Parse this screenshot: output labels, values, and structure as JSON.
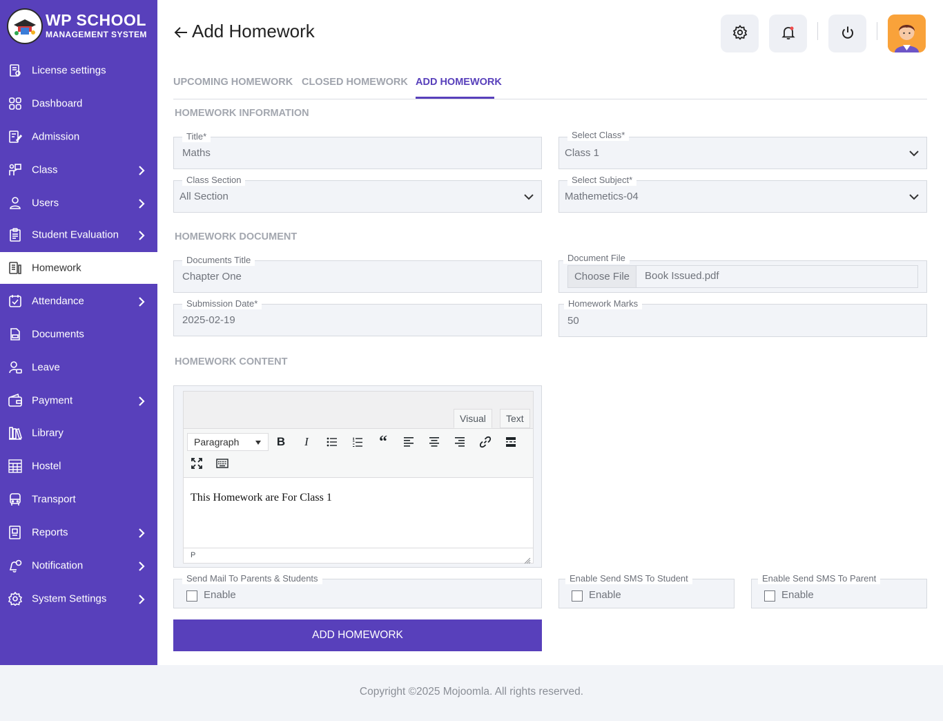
{
  "brand": {
    "title": "WP SCHOOL",
    "subtitle": "MANAGEMENT SYSTEM"
  },
  "sidebar": {
    "items": [
      {
        "label": "License settings",
        "icon": "license-icon",
        "has_submenu": false
      },
      {
        "label": "Dashboard",
        "icon": "grid-icon",
        "has_submenu": false
      },
      {
        "label": "Admission",
        "icon": "admission-icon",
        "has_submenu": false
      },
      {
        "label": "Class",
        "icon": "class-icon",
        "has_submenu": true
      },
      {
        "label": "Users",
        "icon": "user-icon",
        "has_submenu": true
      },
      {
        "label": "Student Evaluation",
        "icon": "evaluation-icon",
        "has_submenu": true
      },
      {
        "label": "Homework",
        "icon": "homework-icon",
        "has_submenu": false,
        "active": true
      },
      {
        "label": "Attendance",
        "icon": "attendance-icon",
        "has_submenu": true
      },
      {
        "label": "Documents",
        "icon": "document-icon",
        "has_submenu": false
      },
      {
        "label": "Leave",
        "icon": "leave-icon",
        "has_submenu": false
      },
      {
        "label": "Payment",
        "icon": "wallet-icon",
        "has_submenu": true
      },
      {
        "label": "Library",
        "icon": "library-icon",
        "has_submenu": false
      },
      {
        "label": "Hostel",
        "icon": "hostel-icon",
        "has_submenu": false
      },
      {
        "label": "Transport",
        "icon": "bus-icon",
        "has_submenu": false
      },
      {
        "label": "Reports",
        "icon": "report-icon",
        "has_submenu": true
      },
      {
        "label": "Notification",
        "icon": "notification-icon",
        "has_submenu": true
      },
      {
        "label": "System Settings",
        "icon": "settings-icon",
        "has_submenu": true
      }
    ]
  },
  "header": {
    "title": "Add Homework"
  },
  "tabs": [
    {
      "label": "UPCOMING HOMEWORK"
    },
    {
      "label": "CLOSED HOMEWORK"
    },
    {
      "label": "ADD HOMEWORK",
      "active": true
    }
  ],
  "sections": {
    "info": "HOMEWORK INFORMATION",
    "document": "HOMEWORK DOCUMENT",
    "content": "HOMEWORK CONTENT"
  },
  "form": {
    "title": {
      "label": "Title*",
      "value": "Maths"
    },
    "class": {
      "label": "Select Class*",
      "value": "Class 1"
    },
    "section": {
      "label": "Class Section",
      "value": "All Section"
    },
    "subject": {
      "label": "Select Subject*",
      "value": "Mathemetics-04"
    },
    "doc_title": {
      "label": "Documents Title",
      "value": "Chapter One"
    },
    "doc_file": {
      "label": "Document File",
      "button": "Choose File",
      "filename": "Book Issued.pdf"
    },
    "submission_date": {
      "label": "Submission Date*",
      "value": "2025-02-19"
    },
    "marks": {
      "label": "Homework Marks",
      "value": "50"
    }
  },
  "editor": {
    "tab_visual": "Visual",
    "tab_text": "Text",
    "format": "Paragraph",
    "content": "This Homework are For Class 1",
    "path": "P"
  },
  "checkboxes": {
    "mail": {
      "label": "Send Mail To Parents & Students",
      "text": "Enable",
      "checked": false
    },
    "sms_student": {
      "label": "Enable Send SMS To Student",
      "text": "Enable",
      "checked": false
    },
    "sms_parent": {
      "label": "Enable Send SMS To Parent",
      "text": "Enable",
      "checked": false
    }
  },
  "submit_label": "ADD HOMEWORK",
  "footer": "Copyright ©2025 Mojoomla. All rights reserved.",
  "colors": {
    "primary": "#5840bb",
    "field_bg": "#f2f4f8",
    "footer_bg": "#f2f4f8",
    "avatar_bg": "#f9a23a"
  }
}
